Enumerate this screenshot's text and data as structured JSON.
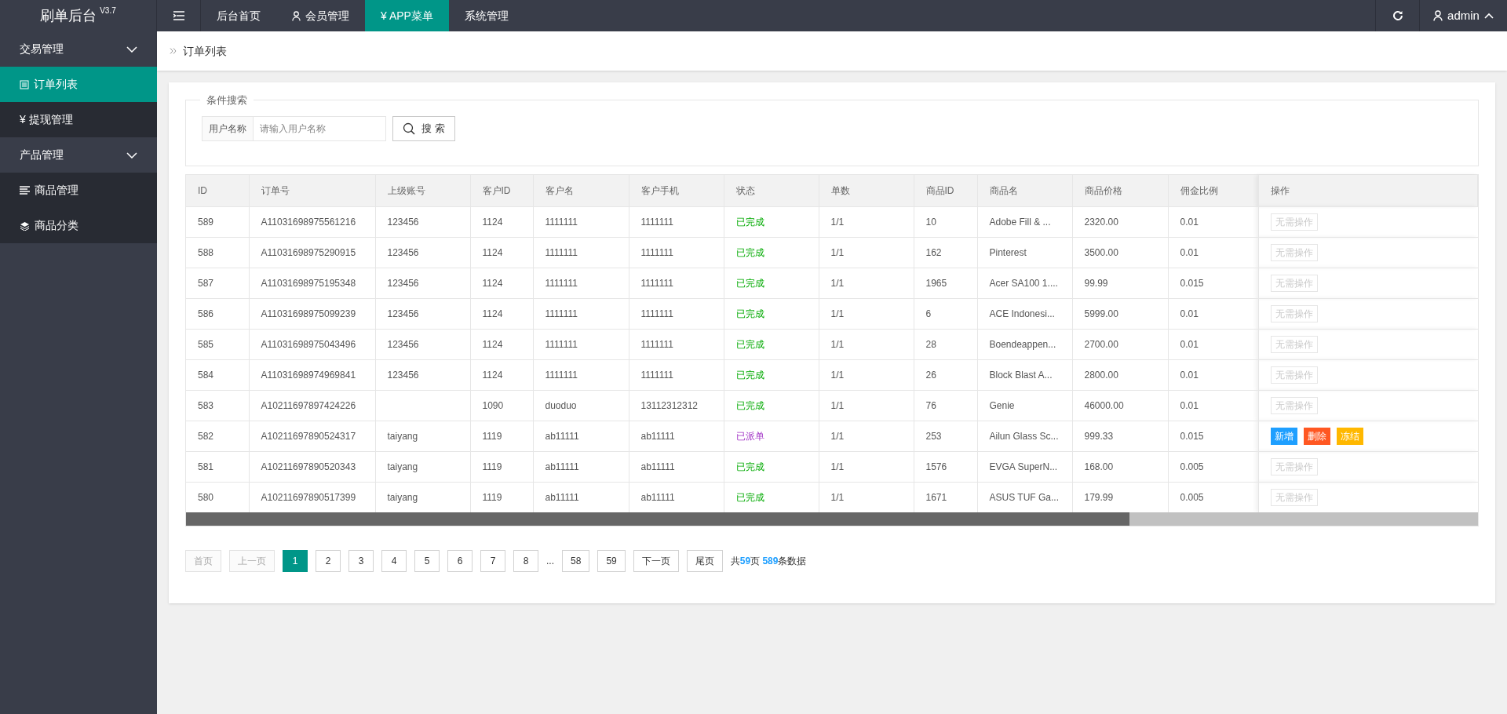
{
  "brand": {
    "title": "刷单后台",
    "version": "V3.7"
  },
  "top_nav": [
    {
      "label": "后台首页",
      "selected": false
    },
    {
      "label": "会员管理",
      "selected": false
    },
    {
      "label": "¥ APP菜单",
      "selected": true
    },
    {
      "label": "系统管理",
      "selected": false
    }
  ],
  "user": {
    "name": "admin"
  },
  "sidebar": [
    {
      "label": "交易管理",
      "expanded": true,
      "children": [
        {
          "label": "订单列表",
          "selected": true
        },
        {
          "label": "¥ 提现管理",
          "selected": false
        }
      ]
    },
    {
      "label": "产品管理",
      "expanded": true,
      "children": [
        {
          "label": "商品管理",
          "selected": false
        },
        {
          "label": "商品分类",
          "selected": false
        }
      ]
    }
  ],
  "breadcrumb": "订单列表",
  "search": {
    "legend": "条件搜索",
    "field_label": "用户名称",
    "placeholder": "请输入用户名称",
    "button": "搜 索"
  },
  "table": {
    "columns": [
      "ID",
      "订单号",
      "上级账号",
      "客户ID",
      "客户名",
      "客户手机",
      "状态",
      "单数",
      "商品ID",
      "商品名",
      "商品价格",
      "佣金比例",
      "操作"
    ],
    "rows": [
      {
        "cells": [
          "589",
          "A11031698975561216",
          "123456",
          "1124",
          "1111111",
          "1111111"
        ],
        "status": {
          "label": "已完成",
          "kind": "done"
        },
        "cells2": [
          "1/1",
          "10",
          "Adobe Fill & ...",
          "2320.00",
          "0.01"
        ],
        "actions": [
          {
            "label": "无需操作",
            "kind": "none"
          }
        ]
      },
      {
        "cells": [
          "588",
          "A11031698975290915",
          "123456",
          "1124",
          "1111111",
          "1111111"
        ],
        "status": {
          "label": "已完成",
          "kind": "done"
        },
        "cells2": [
          "1/1",
          "162",
          "Pinterest",
          "3500.00",
          "0.01"
        ],
        "actions": [
          {
            "label": "无需操作",
            "kind": "none"
          }
        ]
      },
      {
        "cells": [
          "587",
          "A11031698975195348",
          "123456",
          "1124",
          "1111111",
          "1111111"
        ],
        "status": {
          "label": "已完成",
          "kind": "done"
        },
        "cells2": [
          "1/1",
          "1965",
          "Acer SA100 1....",
          "99.99",
          "0.015"
        ],
        "actions": [
          {
            "label": "无需操作",
            "kind": "none"
          }
        ]
      },
      {
        "cells": [
          "586",
          "A11031698975099239",
          "123456",
          "1124",
          "1111111",
          "1111111"
        ],
        "status": {
          "label": "已完成",
          "kind": "done"
        },
        "cells2": [
          "1/1",
          "6",
          "ACE Indonesi...",
          "5999.00",
          "0.01"
        ],
        "actions": [
          {
            "label": "无需操作",
            "kind": "none"
          }
        ]
      },
      {
        "cells": [
          "585",
          "A11031698975043496",
          "123456",
          "1124",
          "1111111",
          "1111111"
        ],
        "status": {
          "label": "已完成",
          "kind": "done"
        },
        "cells2": [
          "1/1",
          "28",
          "Boendeappen...",
          "2700.00",
          "0.01"
        ],
        "actions": [
          {
            "label": "无需操作",
            "kind": "none"
          }
        ]
      },
      {
        "cells": [
          "584",
          "A11031698974969841",
          "123456",
          "1124",
          "1111111",
          "1111111"
        ],
        "status": {
          "label": "已完成",
          "kind": "done"
        },
        "cells2": [
          "1/1",
          "26",
          "Block Blast A...",
          "2800.00",
          "0.01"
        ],
        "actions": [
          {
            "label": "无需操作",
            "kind": "none"
          }
        ]
      },
      {
        "cells": [
          "583",
          "A10211697897424226",
          "",
          "1090",
          "duoduo",
          "13112312312"
        ],
        "status": {
          "label": "已完成",
          "kind": "done"
        },
        "cells2": [
          "1/1",
          "76",
          "Genie",
          "46000.00",
          "0.01"
        ],
        "actions": [
          {
            "label": "无需操作",
            "kind": "none"
          }
        ]
      },
      {
        "cells": [
          "582",
          "A10211697890524317",
          "taiyang",
          "1119",
          "ab11111",
          "ab11111"
        ],
        "status": {
          "label": "已派单",
          "kind": "dispatched"
        },
        "cells2": [
          "1/1",
          "253",
          "Ailun Glass Sc...",
          "999.33",
          "0.015"
        ],
        "actions": [
          {
            "label": "新增",
            "kind": "add"
          },
          {
            "label": "删除",
            "kind": "delete"
          },
          {
            "label": "冻结",
            "kind": "freeze"
          }
        ]
      },
      {
        "cells": [
          "581",
          "A10211697890520343",
          "taiyang",
          "1119",
          "ab11111",
          "ab11111"
        ],
        "status": {
          "label": "已完成",
          "kind": "done"
        },
        "cells2": [
          "1/1",
          "1576",
          "EVGA SuperN...",
          "168.00",
          "0.005"
        ],
        "actions": [
          {
            "label": "无需操作",
            "kind": "none"
          }
        ]
      },
      {
        "cells": [
          "580",
          "A10211697890517399",
          "taiyang",
          "1119",
          "ab11111",
          "ab11111"
        ],
        "status": {
          "label": "已完成",
          "kind": "done"
        },
        "cells2": [
          "1/1",
          "1671",
          "ASUS TUF Ga...",
          "179.99",
          "0.005"
        ],
        "actions": [
          {
            "label": "无需操作",
            "kind": "none"
          }
        ]
      }
    ]
  },
  "pagination": {
    "items": [
      {
        "label": "首页",
        "kind": "nav",
        "disabled": true
      },
      {
        "label": "上一页",
        "kind": "nav",
        "disabled": true
      },
      {
        "label": "1",
        "kind": "page",
        "selected": true
      },
      {
        "label": "2",
        "kind": "page",
        "selected": false
      },
      {
        "label": "3",
        "kind": "page",
        "selected": false
      },
      {
        "label": "4",
        "kind": "page",
        "selected": false
      },
      {
        "label": "5",
        "kind": "page",
        "selected": false
      },
      {
        "label": "6",
        "kind": "page",
        "selected": false
      },
      {
        "label": "7",
        "kind": "page",
        "selected": false
      },
      {
        "label": "8",
        "kind": "page",
        "selected": false
      },
      {
        "label": "...",
        "kind": "ellipsis"
      },
      {
        "label": "58",
        "kind": "page",
        "selected": false
      },
      {
        "label": "59",
        "kind": "page",
        "selected": false
      },
      {
        "label": "下一页",
        "kind": "nav",
        "disabled": false
      },
      {
        "label": "尾页",
        "kind": "nav",
        "disabled": false
      }
    ],
    "summary": "共**59**页 **589**条数据"
  }
}
